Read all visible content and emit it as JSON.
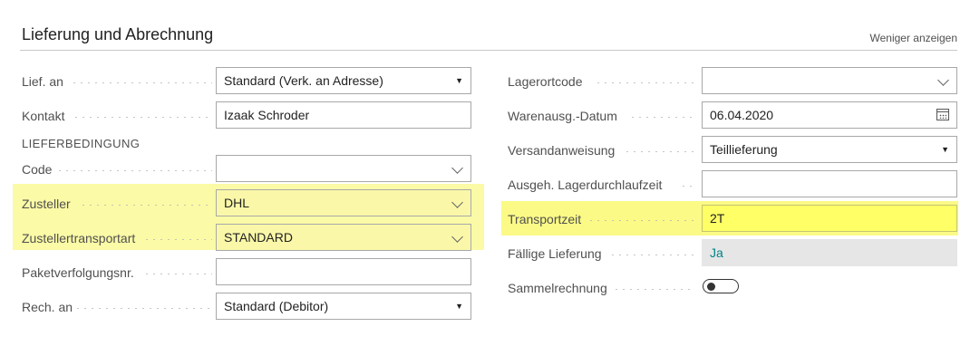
{
  "section": {
    "title": "Lieferung und Abrechnung",
    "toggle_label": "Weniger anzeigen"
  },
  "left": {
    "lief_an": {
      "label": "Lief. an",
      "value": "Standard (Verk. an Adresse)"
    },
    "kontakt": {
      "label": "Kontakt",
      "value": "Izaak Schroder"
    },
    "subheading": "LIEFERBEDINGUNG",
    "code": {
      "label": "Code",
      "value": ""
    },
    "zusteller": {
      "label": "Zusteller",
      "value": "DHL"
    },
    "zustellertransportart": {
      "label": "Zustellertransportart",
      "value": "STANDARD"
    },
    "paketverfolgung": {
      "label": "Paketverfolgungsnr.",
      "value": ""
    },
    "rech_an": {
      "label": "Rech. an",
      "value": "Standard (Debitor)"
    }
  },
  "right": {
    "lagerortcode": {
      "label": "Lagerortcode",
      "value": ""
    },
    "warenausg_datum": {
      "label": "Warenausg.-Datum",
      "value": "06.04.2020"
    },
    "versandanweisung": {
      "label": "Versandanweisung",
      "value": "Teillieferung"
    },
    "lagerdurchlaufzeit": {
      "label": "Ausgeh. Lagerdurchlaufzeit",
      "value": ""
    },
    "transportzeit": {
      "label": "Transportzeit",
      "value": "2T"
    },
    "faellige_lieferung": {
      "label": "Fällige Lieferung",
      "value": "Ja"
    },
    "sammelrechnung": {
      "label": "Sammelrechnung",
      "on": false
    }
  },
  "colors": {
    "highlight_soft": "#faf8a8",
    "highlight_bright": "#ffff66",
    "readonly_bg": "#e6e6e6",
    "readonly_text": "#008489"
  },
  "icons": {
    "dropdown_caret": "caret-down-icon",
    "combobox_chevron": "chevron-down-icon",
    "date_picker": "calendar-icon"
  }
}
